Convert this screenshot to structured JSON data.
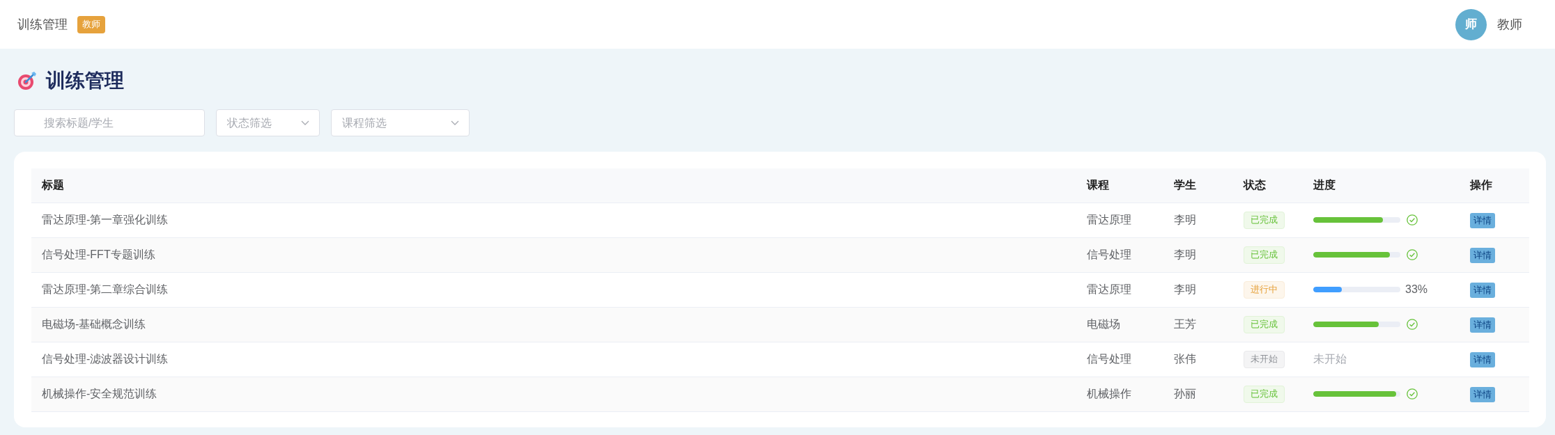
{
  "header": {
    "title": "训练管理",
    "role_badge": "教师",
    "user": {
      "avatar": "师",
      "name": "教师"
    }
  },
  "page": {
    "title": "训练管理"
  },
  "filters": {
    "search": {
      "placeholder": "搜索标题/学生"
    },
    "status": {
      "placeholder": "状态筛选"
    },
    "course": {
      "placeholder": "课程筛选"
    }
  },
  "table": {
    "columns": [
      "标题",
      "课程",
      "学生",
      "状态",
      "进度",
      "操作"
    ],
    "rows": [
      {
        "title": "雷达原理-第一章强化训练",
        "course": "雷达原理",
        "student": "李明",
        "status": {
          "label": "已完成",
          "kind": "success"
        },
        "progress": {
          "kind": "bar",
          "level": 0.8,
          "complete": true
        },
        "action": "详情"
      },
      {
        "title": "信号处理-FFT专题训练",
        "course": "信号处理",
        "student": "李明",
        "status": {
          "label": "已完成",
          "kind": "success"
        },
        "progress": {
          "kind": "bar",
          "level": 0.88,
          "complete": true
        },
        "action": "详情"
      },
      {
        "title": "雷达原理-第二章综合训练",
        "course": "雷达原理",
        "student": "李明",
        "status": {
          "label": "进行中",
          "kind": "warning"
        },
        "progress": {
          "kind": "bar",
          "level": 0.33,
          "complete": false,
          "reading": "33%"
        },
        "action": "详情"
      },
      {
        "title": "电磁场-基础概念训练",
        "course": "电磁场",
        "student": "王芳",
        "status": {
          "label": "已完成",
          "kind": "success"
        },
        "progress": {
          "kind": "bar",
          "level": 0.75,
          "complete": true
        },
        "action": "详情"
      },
      {
        "title": "信号处理-滤波器设计训练",
        "course": "信号处理",
        "student": "张伟",
        "status": {
          "label": "未开始",
          "kind": "info"
        },
        "progress": {
          "kind": "text",
          "text": "未开始"
        },
        "action": "详情"
      },
      {
        "title": "机械操作-安全规范训练",
        "course": "机械操作",
        "student": "孙丽",
        "status": {
          "label": "已完成",
          "kind": "success"
        },
        "progress": {
          "kind": "bar",
          "level": 0.95,
          "complete": true
        },
        "action": "详情"
      }
    ]
  }
}
